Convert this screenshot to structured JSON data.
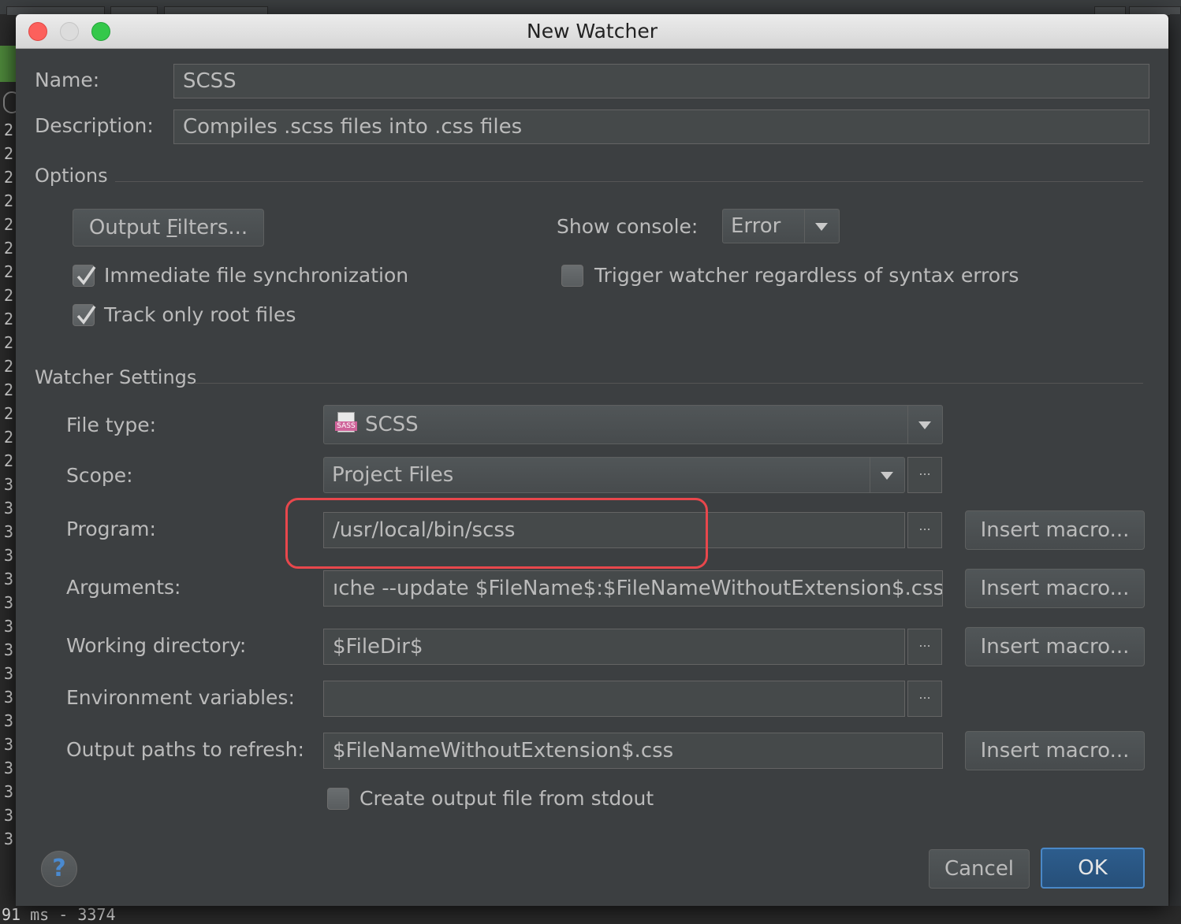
{
  "background": {
    "gutter_digits": [
      "2",
      "2",
      "2",
      "2",
      "2",
      "2",
      "2",
      "2",
      "2",
      "2",
      "2",
      "2",
      "2",
      "2",
      "2",
      "3",
      "3",
      "3",
      "3",
      "3",
      "3",
      "3",
      "3",
      "3",
      "3",
      "3",
      "3",
      "3",
      "3",
      "3",
      "3"
    ],
    "bottom_text": "91 ms - 3374"
  },
  "dialog": {
    "title": "New Watcher",
    "name_label": "Name:",
    "name_value": "SCSS",
    "description_label": "Description:",
    "description_value": "Compiles .scss files into .css files",
    "options_section": "Options",
    "output_filters_prefix": "Output ",
    "output_filters_mnemonic": "F",
    "output_filters_suffix": "ilters...",
    "show_console_label": "Show console:",
    "show_console_value": "Error",
    "immediate_sync_label": "Immediate file synchronization",
    "immediate_sync_checked": true,
    "trigger_watcher_label": "Trigger watcher regardless of syntax errors",
    "trigger_watcher_checked": false,
    "track_root_label": "Track only root files",
    "track_root_checked": true,
    "watcher_settings_section": "Watcher Settings",
    "file_type_label": "File type:",
    "file_type_value": "SCSS",
    "file_type_icon": "sass-file-icon",
    "file_type_icon_text": "SASS",
    "scope_label": "Scope:",
    "scope_value": "Project Files",
    "program_label": "Program:",
    "program_value": "/usr/local/bin/scss",
    "arguments_label": "Arguments:",
    "arguments_value": "ıche --update $FileName$:$FileNameWithoutExtension$.css",
    "working_dir_label": "Working directory:",
    "working_dir_value": "$FileDir$",
    "env_vars_label": "Environment variables:",
    "env_vars_value": "",
    "output_paths_label": "Output paths to refresh:",
    "output_paths_value": "$FileNameWithoutExtension$.css",
    "create_output_label": "Create output file from stdout",
    "create_output_checked": false,
    "ellipsis": "...",
    "insert_macro_label": "Insert macro...",
    "help_label": "?",
    "cancel_label": "Cancel",
    "ok_label": "OK"
  },
  "colors": {
    "dialog_bg": "#3c3f41",
    "field_bg": "#45494a",
    "ok_button": "#2d5d8d",
    "highlight_annotation": "#e8474c",
    "help_icon": "#4a8ad0"
  }
}
